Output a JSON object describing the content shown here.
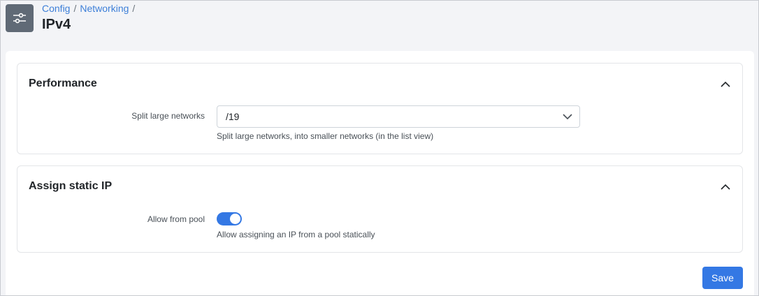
{
  "header": {
    "icon": "sliders-icon",
    "breadcrumb": [
      {
        "label": "Config"
      },
      {
        "label": "Networking"
      }
    ],
    "separator": "/",
    "title": "IPv4"
  },
  "sections": {
    "performance": {
      "title": "Performance",
      "collapse_icon": "chevron-up-icon",
      "split_label": "Split large networks",
      "split_value": "/19",
      "split_help": "Split large networks, into smaller networks (in the list view)"
    },
    "static_ip": {
      "title": "Assign static IP",
      "collapse_icon": "chevron-up-icon",
      "pool_label": "Allow from pool",
      "pool_enabled": true,
      "pool_help": "Allow assigning an IP from a pool statically"
    }
  },
  "actions": {
    "save_label": "Save"
  },
  "colors": {
    "accent": "#3478e4",
    "link": "#3d7fd8",
    "icon_bg": "#606a76"
  }
}
